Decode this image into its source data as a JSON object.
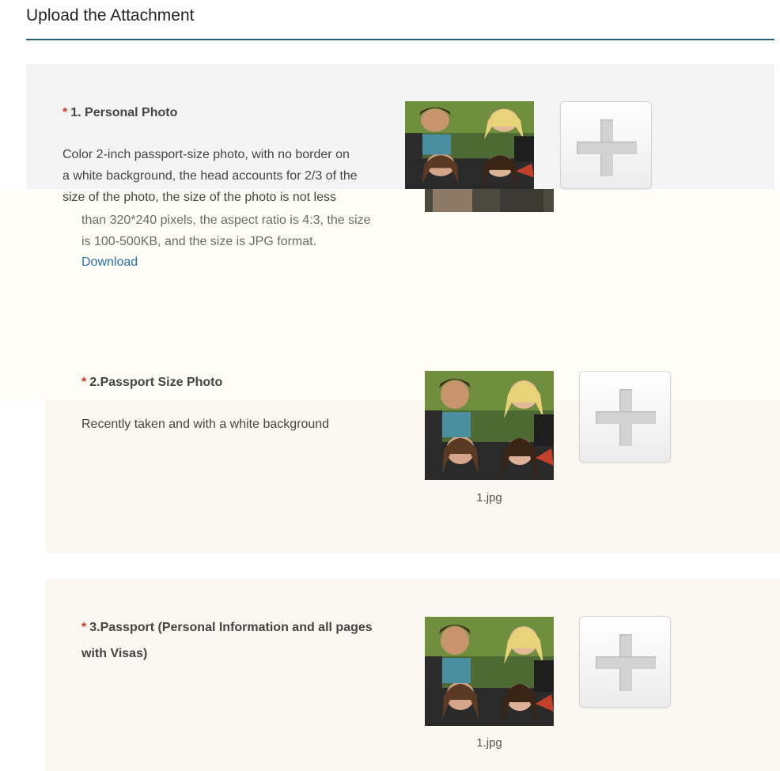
{
  "page": {
    "title": "Upload the Attachment"
  },
  "sections": [
    {
      "required_mark": "*",
      "title": "1. Personal Photo",
      "description_lines": [
        "Color 2-inch passport-size photo, with no border on",
        "a white background, the head accounts for 2/3 of the",
        "size of the photo, the size of the photo is not less"
      ],
      "description_continued": [
        "than 320*240 pixels, the aspect ratio is 4:3, the size",
        "is 100-500KB, and the size is JPG format."
      ],
      "download_label": "Download",
      "thumbnail_icon": "photo-thumbnail",
      "add_icon": "plus-icon"
    },
    {
      "required_mark": "*",
      "title": "2.Passport Size Photo",
      "description_lines": [
        "Recently taken and with a white background"
      ],
      "file_name": "1.jpg",
      "thumbnail_icon": "photo-thumbnail",
      "add_icon": "plus-icon"
    },
    {
      "required_mark": "*",
      "title_lines": [
        "3.Passport (Personal Information and all pages",
        "with Visas)"
      ],
      "file_name": "1.jpg",
      "thumbnail_icon": "photo-thumbnail",
      "add_icon": "plus-icon"
    }
  ],
  "colors": {
    "accent_rule": "#2b5f73",
    "required_star": "#d0342c",
    "link": "#2a6fa8"
  }
}
